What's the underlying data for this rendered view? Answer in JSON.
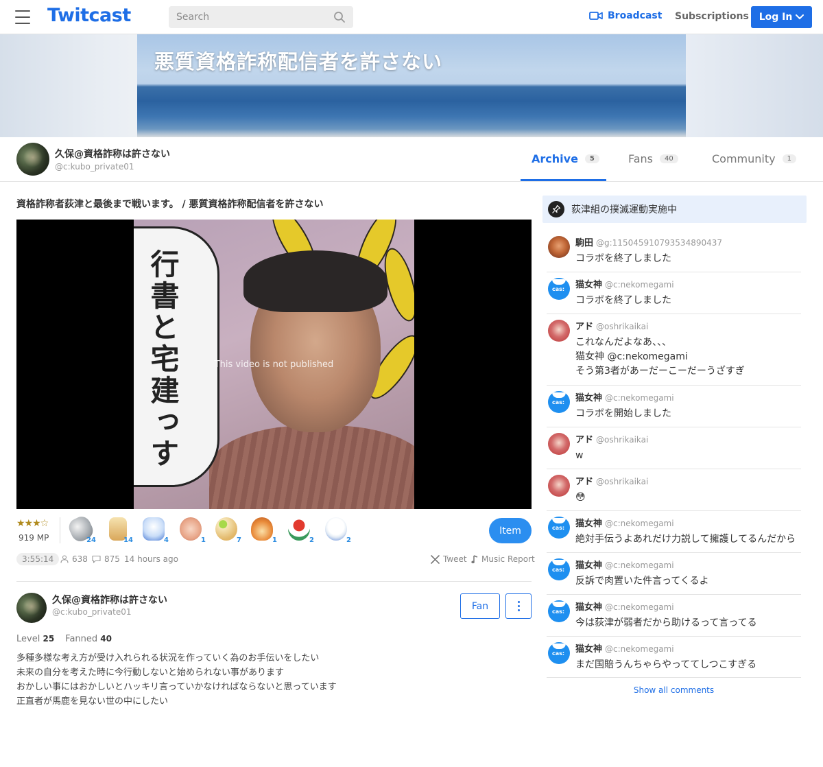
{
  "header": {
    "logo": "Twitcast",
    "search_placeholder": "Search",
    "broadcast_label": "Broadcast",
    "subscriptions_label": "Subscriptions",
    "login_label": "Log In"
  },
  "banner": {
    "title": "悪質資格詐称配信者を許さない"
  },
  "profile": {
    "name": "久保@資格詐称は許さない",
    "id": "@c:kubo_private01",
    "tabs": [
      {
        "label": "Archive",
        "count": "5",
        "active": true
      },
      {
        "label": "Fans",
        "count": "40",
        "active": false
      },
      {
        "label": "Community",
        "count": "1",
        "active": false
      }
    ]
  },
  "movie": {
    "title": "資格詐称者荻津と最後まで戦います。 / 悪質資格詐称配信者を許さない",
    "thumb_caption": "行書と宅建っす",
    "unpublished": "This video is not published",
    "stars": "★★★☆",
    "mp": "919 MP",
    "gifts": [
      {
        "name": "coin-gift-icon",
        "count": "24"
      },
      {
        "name": "tea-gift-icon",
        "count": "14"
      },
      {
        "name": "ghost-gift-icon",
        "count": "4"
      },
      {
        "name": "clap-gift-icon",
        "count": "1"
      },
      {
        "name": "level-gift-icon",
        "count": "7"
      },
      {
        "name": "fire-gift-icon",
        "count": "1"
      },
      {
        "name": "sushi-gift-icon",
        "count": "2"
      },
      {
        "name": "penguin-gift-icon",
        "count": "2"
      }
    ],
    "item_label": "Item",
    "duration": "3:55:14",
    "views": "638",
    "comments": "875",
    "ago": "14 hours ago",
    "tweet_label": "Tweet",
    "music_label": "Music Report"
  },
  "owner": {
    "name": "久保@資格詐称は許さない",
    "id": "@c:kubo_private01",
    "fan_label": "Fan",
    "level_label": "Level",
    "level": "25",
    "fanned_label": "Fanned",
    "fanned": "40",
    "bio": [
      "多種多様な考え方が受け入れられる状況を作っていく為のお手伝いをしたい",
      "未来の自分を考えた時に今行動しないと始められない事があります",
      "おかしい事にはおかしいとハッキリ言っていかなければならないと思っています",
      "正直者が馬鹿を見ない世の中にしたい"
    ]
  },
  "side": {
    "notice": "荻津組の撲滅運動実施中",
    "comments": [
      {
        "name": "駒田",
        "id": "@g:115045910793534890437",
        "text": [
          "コラボを終了しました"
        ],
        "avatar": "koma"
      },
      {
        "name": "猫女神",
        "id": "@c:nekomegami",
        "text": [
          "コラボを終了しました"
        ],
        "avatar": "cas"
      },
      {
        "name": "アド",
        "id": "@oshrikaikai",
        "text": [
          "これなんだよなあ、、、",
          "猫女神 @c:nekomegami",
          "そう第3者があーだーこーだーうざすぎ"
        ],
        "avatar": "ado"
      },
      {
        "name": "猫女神",
        "id": "@c:nekomegami",
        "text": [
          "コラボを開始しました"
        ],
        "avatar": "cas"
      },
      {
        "name": "アド",
        "id": "@oshrikaikai",
        "text": [
          "w"
        ],
        "avatar": "ado"
      },
      {
        "name": "アド",
        "id": "@oshrikaikai",
        "text": [
          "😳"
        ],
        "avatar": "ado"
      },
      {
        "name": "猫女神",
        "id": "@c:nekomegami",
        "text": [
          "絶対手伝うよあれだけ力説して擁護してるんだから"
        ],
        "avatar": "cas"
      },
      {
        "name": "猫女神",
        "id": "@c:nekomegami",
        "text": [
          "反訴で肉置いた件言ってくるよ"
        ],
        "avatar": "cas"
      },
      {
        "name": "猫女神",
        "id": "@c:nekomegami",
        "text": [
          "今は荻津が弱者だから助けるって言ってる"
        ],
        "avatar": "cas"
      },
      {
        "name": "猫女神",
        "id": "@c:nekomegami",
        "text": [
          "まだ国賠うんちゃらやっててしつこすぎる"
        ],
        "avatar": "cas"
      }
    ],
    "show_all": "Show all comments"
  }
}
